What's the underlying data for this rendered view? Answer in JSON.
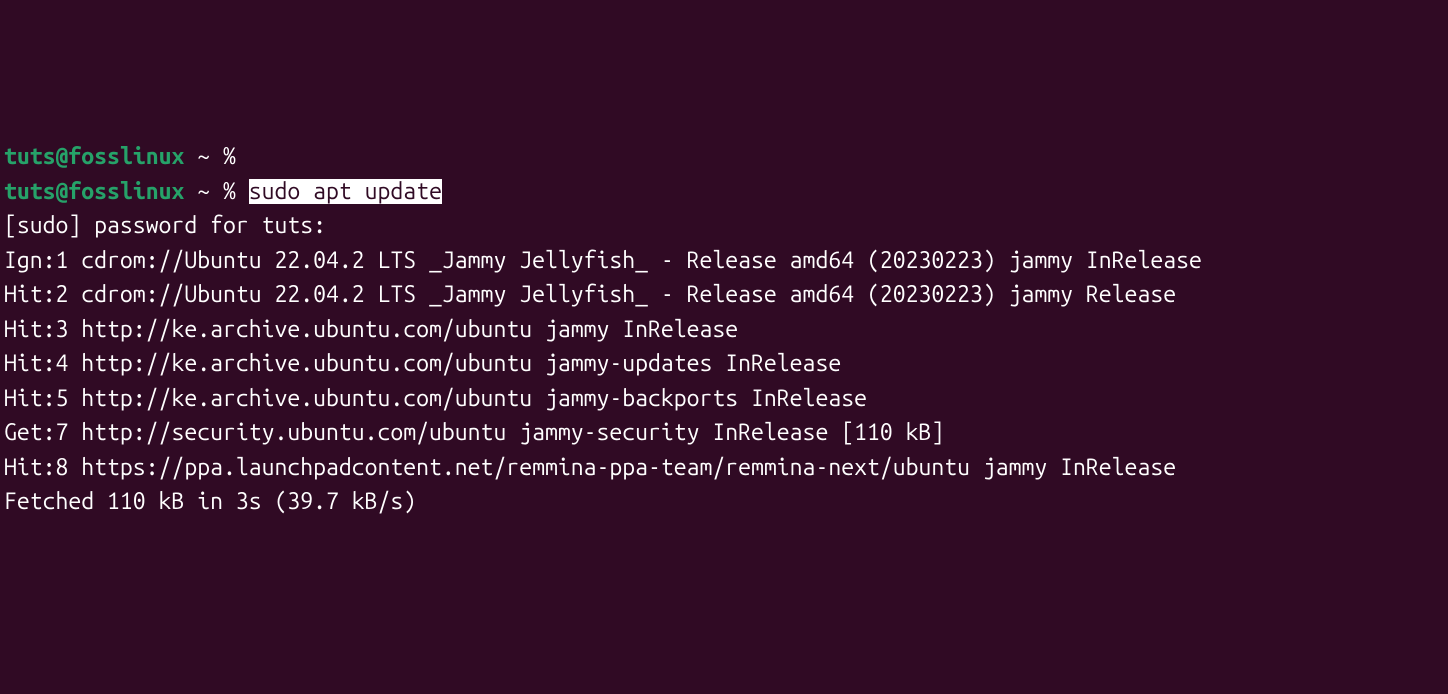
{
  "prompt1": {
    "user": "tuts",
    "at": "@",
    "host": "fosslinux",
    "path": " ~ ",
    "symbol": "% "
  },
  "prompt2": {
    "user": "tuts",
    "at": "@",
    "host": "fosslinux",
    "path": " ~ ",
    "symbol": "% ",
    "command": "sudo apt update"
  },
  "output": {
    "sudo_prompt": "[sudo] password for tuts:",
    "line1": "Ign:1 cdrom://Ubuntu 22.04.2 LTS _Jammy Jellyfish_ - Release amd64 (20230223) jammy InRelease",
    "line2": "Hit:2 cdrom://Ubuntu 22.04.2 LTS _Jammy Jellyfish_ - Release amd64 (20230223) jammy Release",
    "line3": "Hit:3 http://ke.archive.ubuntu.com/ubuntu jammy InRelease",
    "line4": "Hit:4 http://ke.archive.ubuntu.com/ubuntu jammy-updates InRelease",
    "line5": "Hit:5 http://ke.archive.ubuntu.com/ubuntu jammy-backports InRelease",
    "line6": "Get:7 http://security.ubuntu.com/ubuntu jammy-security InRelease [110 kB]",
    "line7": "Hit:8 https://ppa.launchpadcontent.net/remmina-ppa-team/remmina-next/ubuntu jammy InRelease",
    "line8": "Fetched 110 kB in 3s (39.7 kB/s)"
  }
}
